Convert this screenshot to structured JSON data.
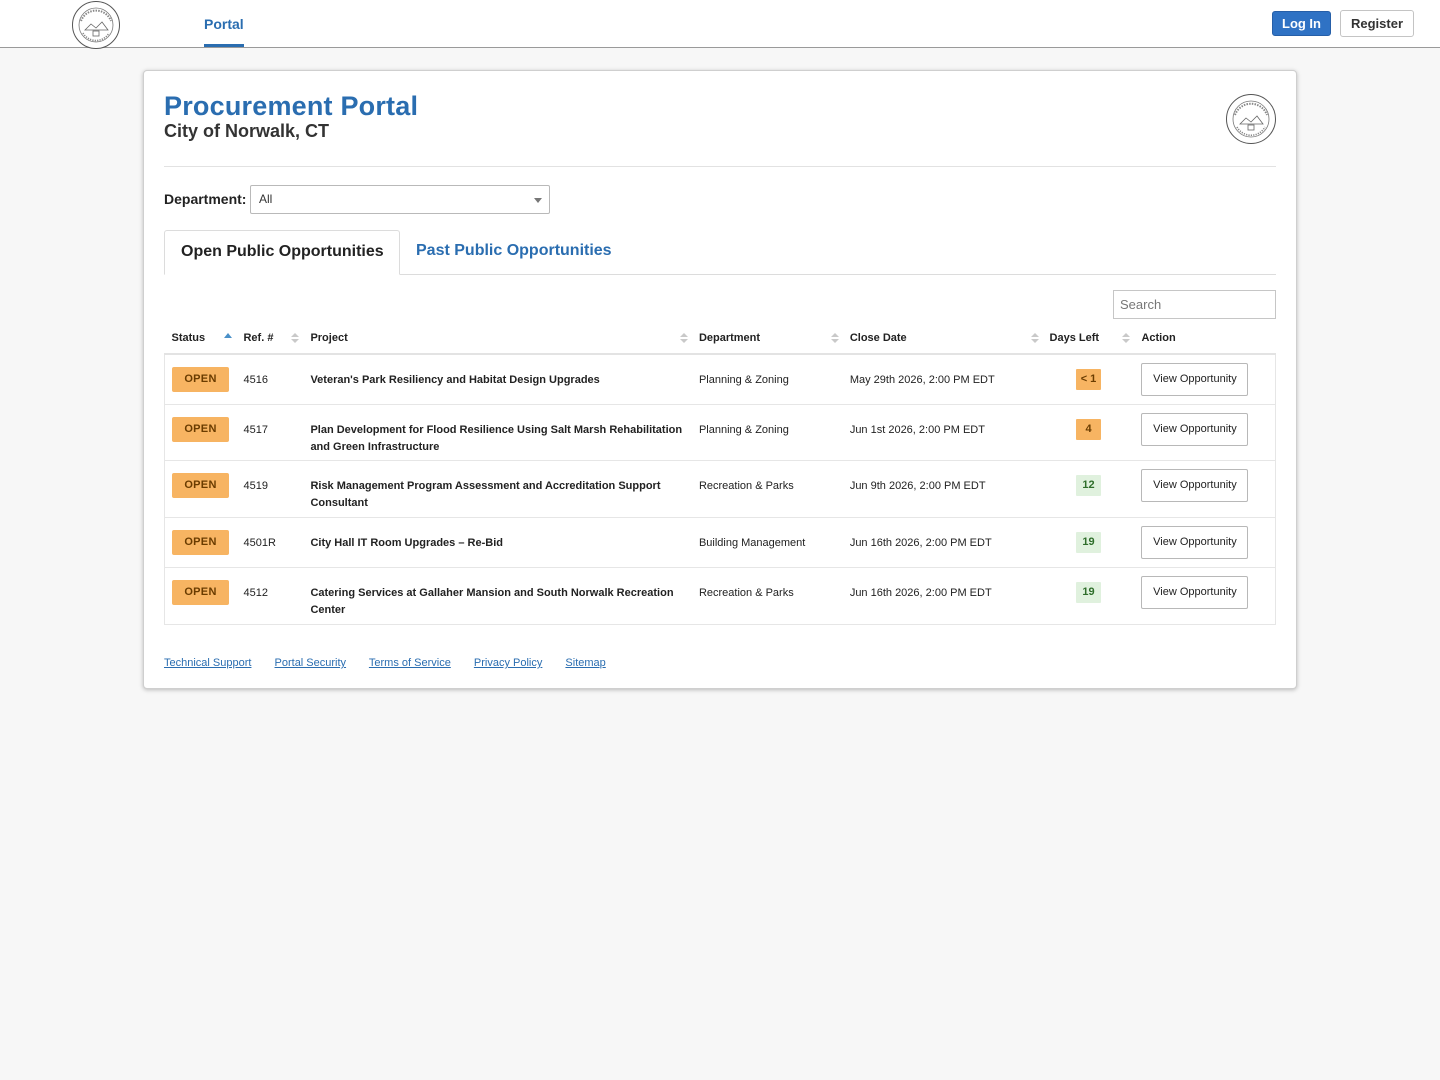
{
  "nav": {
    "portal_label": "Portal",
    "login_label": "Log In",
    "register_label": "Register"
  },
  "header": {
    "title": "Procurement Portal",
    "subtitle": "City of Norwalk, CT"
  },
  "filter": {
    "department_label": "Department:",
    "department_value": "All"
  },
  "tabs": {
    "open_label": "Open Public Opportunities",
    "past_label": "Past Public Opportunities"
  },
  "search": {
    "placeholder": "Search"
  },
  "table": {
    "columns": {
      "status": "Status",
      "ref": "Ref. #",
      "project": "Project",
      "department": "Department",
      "close_date": "Close Date",
      "days_left": "Days Left",
      "action": "Action"
    },
    "rows": [
      {
        "status": "OPEN",
        "ref": "4516",
        "project": "Veteran's Park Resiliency and Habitat Design Upgrades",
        "department": "Planning & Zoning",
        "close_date": "May 29th 2026, 2:00 PM EDT",
        "days_left": "< 1",
        "action": "View Opportunity"
      },
      {
        "status": "OPEN",
        "ref": "4517",
        "project": "Plan Development for Flood Resilience Using Salt Marsh Rehabilitation and Green Infrastructure",
        "department": "Planning & Zoning",
        "close_date": "Jun 1st 2026, 2:00 PM EDT",
        "days_left": "4",
        "action": "View Opportunity"
      },
      {
        "status": "OPEN",
        "ref": "4519",
        "project": "Risk Management Program Assessment and Accreditation Support Consultant",
        "department": "Recreation & Parks",
        "close_date": "Jun 9th 2026, 2:00 PM EDT",
        "days_left": "12",
        "action": "View Opportunity"
      },
      {
        "status": "OPEN",
        "ref": "4501R",
        "project": "City Hall IT Room Upgrades – Re-Bid",
        "department": "Building Management",
        "close_date": "Jun 16th 2026, 2:00 PM EDT",
        "days_left": "19",
        "action": "View Opportunity"
      },
      {
        "status": "OPEN",
        "ref": "4512",
        "project": "Catering Services at Gallaher Mansion and South Norwalk Recreation Center",
        "department": "Recreation & Parks",
        "close_date": "Jun 16th 2026, 2:00 PM EDT",
        "days_left": "19",
        "action": "View Opportunity"
      }
    ]
  },
  "footer": {
    "links": [
      "Technical Support",
      "Portal Security",
      "Terms of Service",
      "Privacy Policy",
      "Sitemap"
    ]
  },
  "icons": {
    "nav_seal": "city-seal-icon",
    "card_seal": "city-seal-icon",
    "sort": "sort-arrows-icon",
    "dropdown": "chevron-down-icon"
  },
  "colors": {
    "brand_blue": "#2a6db0",
    "login_button": "#2f72c4",
    "status_open": "#f7b462",
    "days_ok": "#e0f1de",
    "days_ok_text": "#2f6e2b"
  }
}
